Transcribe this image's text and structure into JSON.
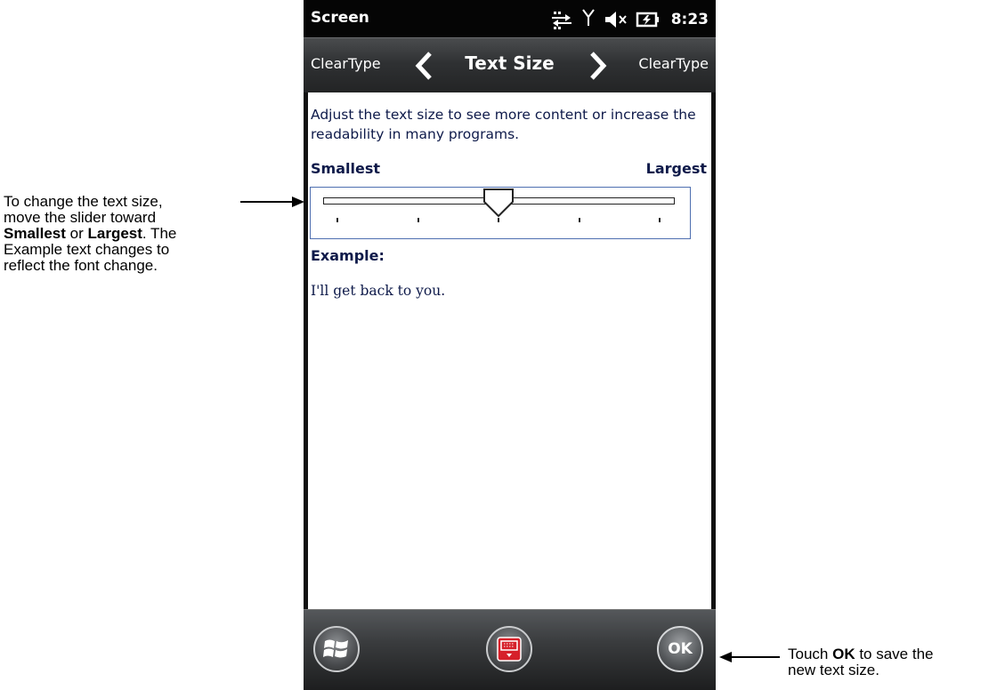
{
  "statusbar": {
    "title": "Screen",
    "time": "8:23",
    "icons": [
      "data-sync-icon",
      "signal-icon",
      "speaker-muted-icon",
      "battery-charging-icon"
    ]
  },
  "navbar": {
    "prev_label": "ClearType",
    "title": "Text Size",
    "next_label": "ClearType"
  },
  "content": {
    "description": "Adjust the text size to see more content or increase the readability in many programs.",
    "scale_min_label": "Smallest",
    "scale_max_label": "Largest",
    "slider": {
      "steps": 5,
      "selected_index": 2
    },
    "example_label": "Example:",
    "example_text": "I'll get back to you."
  },
  "bottombar": {
    "ok_label": "OK"
  },
  "callouts": {
    "left": {
      "line1": "To change the text size,",
      "line2": "move the slider toward",
      "smallest": "Smallest",
      "or": " or ",
      "largest": "Largest",
      "line3_rest": ". The",
      "line4": "Example text changes to",
      "line5": "reflect the font change."
    },
    "right": {
      "prefix": "Touch ",
      "ok": "OK",
      "suffix": " to save the",
      "line2": "new text size."
    }
  },
  "colors": {
    "content_text": "#0e1a4a",
    "slider_border": "#4f6fb0",
    "keyboard_red": "#d6202a"
  }
}
